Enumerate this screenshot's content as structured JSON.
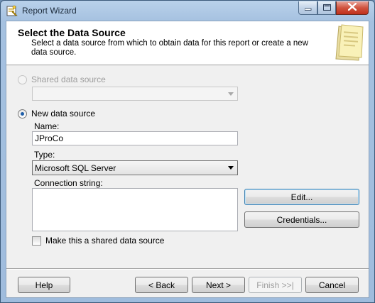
{
  "window": {
    "title": "Report Wizard",
    "icon": "report-wizard-icon"
  },
  "header": {
    "title": "Select the Data Source",
    "description": "Select a data source from which to obtain data for this report or create a new data source."
  },
  "shared_source": {
    "label": "Shared data source",
    "selected": false,
    "enabled": false,
    "value": ""
  },
  "new_source": {
    "label": "New data source",
    "selected": true,
    "name_label": "Name:",
    "name_value": "JProCo",
    "type_label": "Type:",
    "type_value": "Microsoft SQL Server",
    "connection_label": "Connection string:",
    "connection_value": ""
  },
  "buttons": {
    "edit": "Edit...",
    "credentials": "Credentials...",
    "help": "Help",
    "back": "< Back",
    "next": "Next >",
    "finish": "Finish >>|",
    "cancel": "Cancel"
  },
  "make_shared": {
    "label": "Make this a shared data source",
    "checked": false
  },
  "colors": {
    "titlebar": "#b9d1ea",
    "radio_dot": "#1f5ea8",
    "close_button": "#c0311c"
  }
}
